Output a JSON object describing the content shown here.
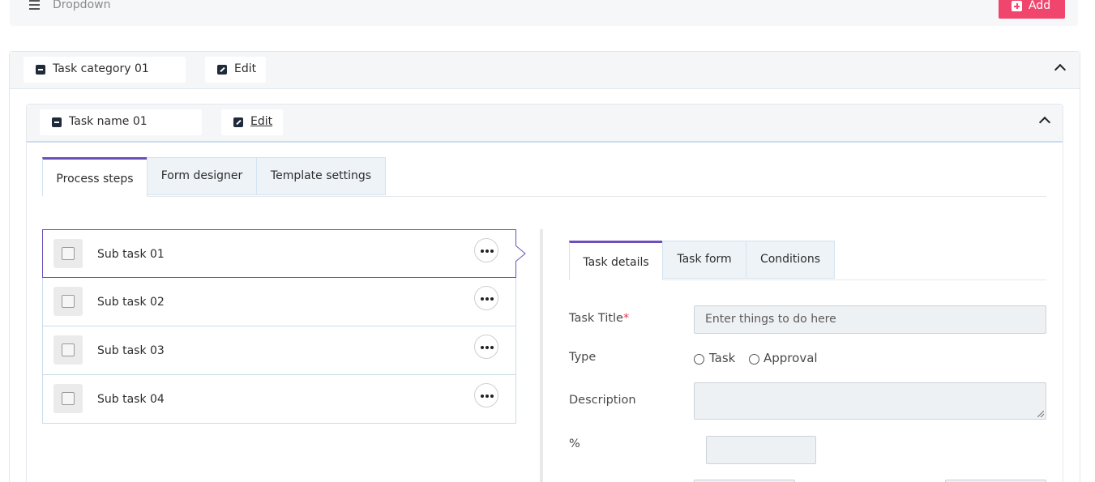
{
  "header": {
    "title": "Dropdown",
    "add_label": "Add"
  },
  "category": {
    "name": "Task category 01",
    "edit_label": "Edit"
  },
  "task": {
    "name": "Task name 01",
    "edit_label": "Edit"
  },
  "main_tabs": [
    {
      "label": "Process steps",
      "active": true
    },
    {
      "label": "Form designer",
      "active": false
    },
    {
      "label": "Template settings",
      "active": false
    }
  ],
  "subtasks": [
    {
      "name": "Sub task 01",
      "selected": true
    },
    {
      "name": "Sub task 02",
      "selected": false
    },
    {
      "name": "Sub task 03",
      "selected": false
    },
    {
      "name": "Sub task 04",
      "selected": false
    }
  ],
  "detail_tabs": [
    {
      "label": "Task details",
      "active": true
    },
    {
      "label": "Task form",
      "active": false
    },
    {
      "label": "Conditions",
      "active": false
    }
  ],
  "form": {
    "title_label": "Task Title",
    "required_mark": "*",
    "title_placeholder": "Enter things to do here",
    "type_label": "Type",
    "type_options": [
      "Task",
      "Approval"
    ],
    "description_label": "Description",
    "percent_label": "%"
  },
  "colors": {
    "accent": "#6b4fbb",
    "add_button": "#f0466e",
    "tab_inactive_bg": "#eef3f8",
    "required": "#e53950"
  }
}
